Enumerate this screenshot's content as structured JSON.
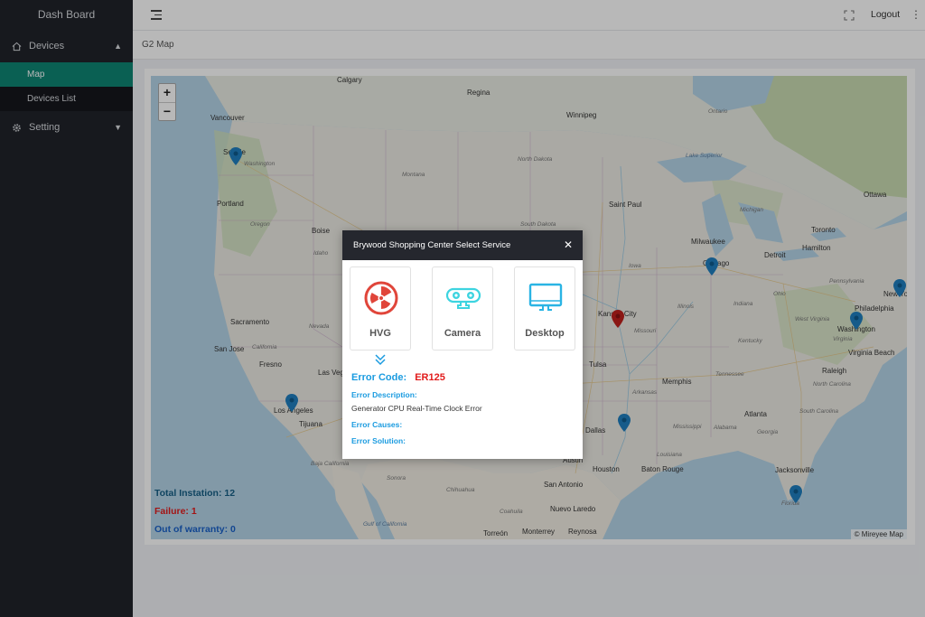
{
  "sidebar": {
    "brand": "Dash Board",
    "groups": [
      {
        "label": "Devices",
        "icon": "home-icon",
        "expanded": true,
        "items": [
          {
            "label": "Map",
            "active": true
          },
          {
            "label": "Devices List",
            "active": false
          }
        ]
      },
      {
        "label": "Setting",
        "icon": "gear-icon",
        "expanded": false,
        "items": []
      }
    ]
  },
  "topbar": {
    "logout_label": "Logout",
    "menu_icon": "hamburger-icon",
    "fullscreen_icon": "fullscreen-icon",
    "more_icon": "more-vertical-icon"
  },
  "breadcrumb": "G2 Map",
  "map": {
    "zoom_in": "+",
    "zoom_out": "−",
    "attribution": "© Mireyee Map",
    "cities": [
      "Calgary",
      "Regina",
      "Winnipeg",
      "Vancouver",
      "Seattle",
      "Portland",
      "Boise",
      "Sacramento",
      "San Jose",
      "Fresno",
      "Las Vegas",
      "Los Angeles",
      "Tijuana",
      "Saint Paul",
      "Milwaukee",
      "Chicago",
      "Detroit",
      "Toronto",
      "Ottawa",
      "Hamilton",
      "Kansas City",
      "Tulsa",
      "Memphis",
      "Dallas",
      "Houston",
      "Austin",
      "San Antonio",
      "Baton Rouge",
      "Atlanta",
      "Raleigh",
      "Washington",
      "Virginia Beach",
      "Philadelphia",
      "New York",
      "Jacksonville",
      "Nuevo Laredo",
      "Monterrey",
      "Reynosa",
      "Torreón"
    ],
    "regions": [
      "Washington",
      "Montana",
      "North Dakota",
      "South Dakota",
      "Oregon",
      "Idaho",
      "Nevada",
      "California",
      "Iowa",
      "Illinois",
      "Missouri",
      "Arkansas",
      "Tennessee",
      "Mississippi",
      "Alabama",
      "Georgia",
      "Kentucky",
      "Ohio",
      "Indiana",
      "Michigan",
      "Pennsylvania",
      "West Virginia",
      "Virginia",
      "North Carolina",
      "South Carolina",
      "Louisiana",
      "Florida",
      "Ontario",
      "Sonora",
      "Chihuahua",
      "Coahuila",
      "Baja California",
      "Lake Superior",
      "Gulf of California"
    ],
    "markers": {
      "normal_color": "#1f7fbf",
      "failure_color": "#c0201d"
    },
    "stats": {
      "total_label": "Total Instation:",
      "total": "12",
      "total_color": "#155f86",
      "failure_label": "Failure:",
      "failure": "1",
      "failure_color": "#e21c1c",
      "warranty_label": "Out of warranty:",
      "warranty": "0",
      "warranty_color": "#1a62c9"
    }
  },
  "modal": {
    "title": "Brywood Shopping Center Select Service",
    "close_icon": "close-icon",
    "services": [
      {
        "label": "HVG",
        "icon": "radiation-icon",
        "color": "#e0453a"
      },
      {
        "label": "Camera",
        "icon": "camera-icon",
        "color": "#3dd4e0"
      },
      {
        "label": "Desktop",
        "icon": "monitor-icon",
        "color": "#2ab4e4"
      }
    ],
    "error": {
      "code_label": "Error Code:",
      "code": "ER125",
      "description_label": "Error Description:",
      "description": "Generator CPU Real-Time Clock Error",
      "causes_label": "Error Causes:",
      "solution_label": "Error Solution:"
    }
  }
}
